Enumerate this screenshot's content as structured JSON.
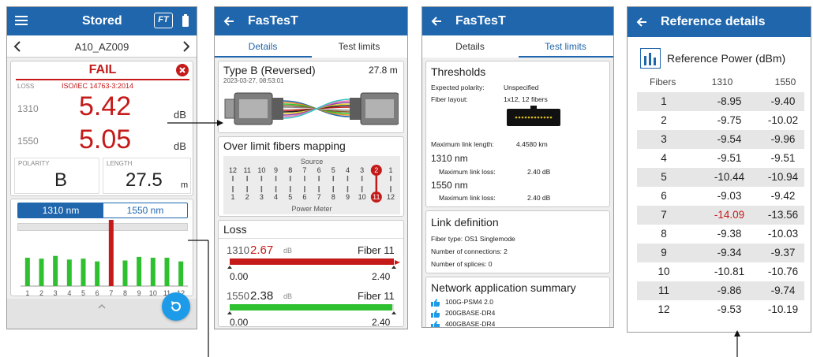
{
  "p1": {
    "title": "Stored",
    "ft_badge": "FT",
    "nav_label": "A10_AZ009",
    "result": "FAIL",
    "loss_label": "LOSS",
    "standard": "ISO/IEC 14763-3:2014",
    "rows": [
      {
        "wavelength": "1310",
        "value": "5.42",
        "unit": "dB"
      },
      {
        "wavelength": "1550",
        "value": "5.05",
        "unit": "dB"
      }
    ],
    "polarity_label": "POLARITY",
    "polarity_value": "B",
    "length_label": "LENGTH",
    "length_value": "27.5",
    "length_unit": "m",
    "seg_1310": "1310 nm",
    "seg_1550": "1550 nm",
    "chart_data": {
      "type": "bar",
      "categories": [
        "1",
        "2",
        "3",
        "4",
        "5",
        "6",
        "7",
        "8",
        "9",
        "10",
        "11",
        "12"
      ],
      "values": [
        0.62,
        0.6,
        0.66,
        0.58,
        0.6,
        0.54,
        1.0,
        0.56,
        0.64,
        0.62,
        0.62,
        0.54
      ],
      "fail_index": 6,
      "colors": {
        "pass": "#2ec02e",
        "fail": "#c41a1a"
      }
    }
  },
  "p2": {
    "title": "FasTesT",
    "tab_details": "Details",
    "tab_limits": "Test limits",
    "type_title": "Type B (Reversed)",
    "type_length": "27.8 m",
    "type_date": "2023-03-27, 08:53:01",
    "mapping_title": "Over limit fibers mapping",
    "source_label": "Source",
    "power_meter_label": "Power Meter",
    "source_numbers": [
      "12",
      "11",
      "10",
      "9",
      "8",
      "7",
      "6",
      "5",
      "4",
      "3",
      "2",
      "1"
    ],
    "meter_numbers": [
      "1",
      "2",
      "3",
      "4",
      "5",
      "6",
      "7",
      "8",
      "9",
      "10",
      "11",
      "12"
    ],
    "loss_title": "Loss",
    "loss_rows": [
      {
        "wavelength": "1310",
        "value": "2.67",
        "unit": "dB",
        "fiber": "Fiber 11",
        "min": "0.00",
        "max": "2.40",
        "status": "fail",
        "fill": 1.0
      },
      {
        "wavelength": "1550",
        "value": "2.38",
        "unit": "dB",
        "fiber": "Fiber 11",
        "min": "0.00",
        "max": "2.40",
        "status": "pass",
        "fill": 0.99
      }
    ]
  },
  "p3": {
    "title": "FasTesT",
    "tab_details": "Details",
    "tab_limits": "Test limits",
    "thresholds_title": "Thresholds",
    "expected_polarity_label": "Expected polarity:",
    "expected_polarity_value": "Unspecified",
    "fiber_layout_label": "Fiber layout:",
    "fiber_layout_value": "1x12, 12 fibers",
    "max_link_length_label": "Maximum link length:",
    "max_link_length_value": "4.4580 km",
    "nm1310": "1310 nm",
    "max_link_loss_label": "Maximum link loss:",
    "max_link_loss_1310": "2.40 dB",
    "nm1550": "1550 nm",
    "max_link_loss_1550": "2.40 dB",
    "link_def_title": "Link definition",
    "fiber_type": "Fiber type: OS1 Singlemode",
    "connections": "Number of connections: 2",
    "splices": "Number of splices: 0",
    "net_app_title": "Network application summary",
    "apps": [
      "100G-PSM4 2.0",
      "200GBASE-DR4",
      "400GBASE-DR4"
    ]
  },
  "p4": {
    "title": "Reference details",
    "ref_power_title": "Reference Power (dBm)",
    "col_fibers": "Fibers",
    "col_1310": "1310",
    "col_1550": "1550",
    "rows": [
      {
        "fiber": "1",
        "v1310": "-8.95",
        "v1550": "-9.40"
      },
      {
        "fiber": "2",
        "v1310": "-9.75",
        "v1550": "-10.02"
      },
      {
        "fiber": "3",
        "v1310": "-9.54",
        "v1550": "-9.96"
      },
      {
        "fiber": "4",
        "v1310": "-9.51",
        "v1550": "-9.51"
      },
      {
        "fiber": "5",
        "v1310": "-10.44",
        "v1550": "-10.94"
      },
      {
        "fiber": "6",
        "v1310": "-9.03",
        "v1550": "-9.42"
      },
      {
        "fiber": "7",
        "v1310": "-14.09",
        "v1550": "-13.56",
        "highlight": true
      },
      {
        "fiber": "8",
        "v1310": "-9.38",
        "v1550": "-10.03"
      },
      {
        "fiber": "9",
        "v1310": "-9.34",
        "v1550": "-9.37"
      },
      {
        "fiber": "10",
        "v1310": "-10.81",
        "v1550": "-10.76"
      },
      {
        "fiber": "11",
        "v1310": "-9.86",
        "v1550": "-9.74"
      },
      {
        "fiber": "12",
        "v1310": "-9.53",
        "v1550": "-10.19"
      }
    ]
  },
  "colors": {
    "appbar": "#1f66ad",
    "fail": "#c41a1a",
    "pass": "#2ec02e",
    "fab": "#1e9be8"
  }
}
